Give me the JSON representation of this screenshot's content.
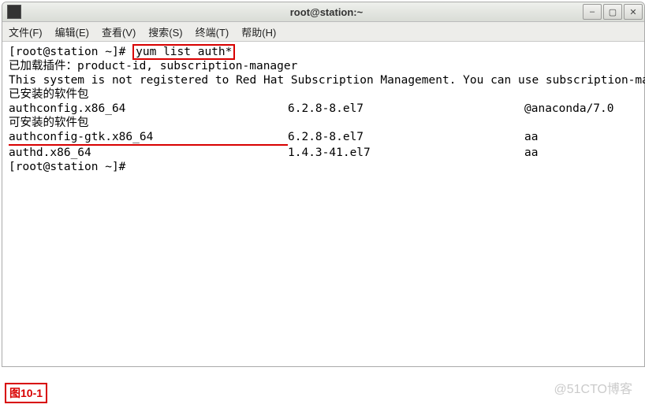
{
  "window": {
    "title": "root@station:~"
  },
  "window_buttons": {
    "min_glyph": "–",
    "max_glyph": "▢",
    "close_glyph": "✕"
  },
  "menu": {
    "file": "文件(F)",
    "edit": "编辑(E)",
    "view": "查看(V)",
    "search": "搜索(S)",
    "term": "终端(T)",
    "help": "帮助(H)"
  },
  "terminal": {
    "prompt1a": "[root@station ~]# ",
    "cmd1": "yum list auth*",
    "line_plugins": "已加载插件：product-id, subscription-manager",
    "line_reg": "This system is not registered to Red Hat Subscription Management. You can use subscription-manager to register.",
    "installed_header": "已安装的软件包",
    "available_header": "可安装的软件包",
    "rows": [
      {
        "name": "authconfig.x86_64",
        "ver": "6.2.8-8.el7",
        "repo": "@anaconda/7.0",
        "section": "installed"
      },
      {
        "name": "authconfig-gtk.x86_64",
        "ver": "6.2.8-8.el7",
        "repo": "aa",
        "section": "available",
        "underline": true
      },
      {
        "name": "authd.x86_64",
        "ver": "1.4.3-41.el7",
        "repo": "aa",
        "section": "available"
      }
    ],
    "prompt2": "[root@station ~]# "
  },
  "figure_label": "图10-1",
  "watermark": "@51CTO博客"
}
